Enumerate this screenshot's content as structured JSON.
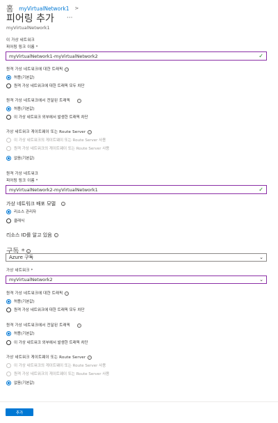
{
  "breadcrumb": {
    "home": "홈",
    "resource": "myVirtualNetwork1",
    "separator": ">"
  },
  "header": {
    "title": "피어링 추가",
    "more": "···",
    "subtitle": "myVirtualNetwork1"
  },
  "this_vnet": {
    "section_label": "이 가상 네트워크",
    "link_name_label": "피어링 링크 이름 *",
    "link_name_value": "myVirtualNetwork1-myVirtualNetwork2",
    "remote_access_label": "원격 가상 네트워크에 대한 트래픽",
    "remote_access_options": [
      "허용(기본값)",
      "원격 가상 네트워크에 대한 트래픽 모두 차단"
    ],
    "forwarded_label": "원격 가상 네트워크에서 전달된 트래픽",
    "forwarded_options": [
      "허용(기본값)",
      "이 가상 네트워크 외부에서 발생한 트래픽 차단"
    ],
    "gateway_label": "가상 네트워크 게이트웨이 또는 Route Server",
    "gateway_options": [
      "이 가상 네트워크의 게이트웨이 또는 Route Server 사용",
      "원격 가상 네트워크의 게이트웨이 또는 Route Server 사용",
      "없음(기본값)"
    ]
  },
  "remote_vnet": {
    "section_label": "원격 가상 네트워크",
    "link_name_label": "피어링 링크 이름 *",
    "link_name_value": "myVirtualNetwork2-myVirtualNetwork1",
    "deploy_model_label": "가상 네트워크 배포 모델",
    "deploy_model_options": [
      "리소스 관리자",
      "클래식"
    ],
    "resource_id_label": "리소스 ID를 알고 있음",
    "subscription_label": "구독 *",
    "subscription_value": "Azure 구독",
    "vnet_label": "가상 네트워크 *",
    "vnet_value": "myVirtualNetwork2",
    "remote_access_label": "원격 가상 네트워크에 대한 트래픽",
    "remote_access_options": [
      "허용(기본값)",
      "원격 가상 네트워크에 대한 트래픽 모두 차단"
    ],
    "forwarded_label": "원격 가상 네트워크에서 전달된 트래픽",
    "forwarded_options": [
      "허용(기본값)",
      "이 가상 네트워크 외부에서 발생한 트래픽 차단"
    ],
    "gateway_label": "가상 네트워크 게이트웨이 또는 Route Server",
    "gateway_options": [
      "이 가상 네트워크의 게이트웨이 또는 Route Server 사용",
      "원격 가상 네트워크의 게이트웨이 또는 Route Server 사용",
      "없음(기본값)"
    ]
  },
  "footer": {
    "add_label": "추가"
  },
  "colors": {
    "accent": "#0078d4",
    "focus_border": "#8a2da5",
    "valid": "#107c10"
  }
}
